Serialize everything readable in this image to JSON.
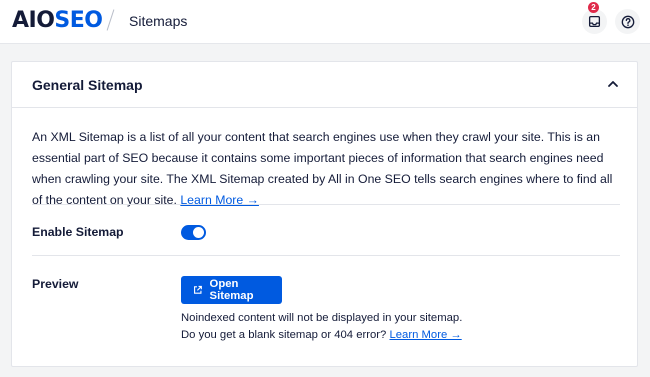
{
  "header": {
    "logo_text": "AIO",
    "logo_accent": "SEO",
    "breadcrumb": "Sitemaps",
    "notification_count": "2",
    "icons": [
      "inbox-icon",
      "help-icon"
    ]
  },
  "card": {
    "title": "General Sitemap",
    "collapse_icon": "chevron-up-icon",
    "description": "An XML Sitemap is a list of all your content that search engines use when they crawl your site. This is an essential part of SEO because it contains some important pieces of information that search engines need when crawling your site. The XML Sitemap created by All in One SEO tells search engines where to find all of the content on your site.",
    "learn_more": "Learn More →"
  },
  "enable_sitemap": {
    "label": "Enable Sitemap",
    "enabled": true
  },
  "preview": {
    "label": "Preview",
    "button_label": "Open Sitemap",
    "button_icon": "external-link-icon",
    "note": "Noindexed content will not be displayed in your sitemap.",
    "blank_question": "Do you get a blank sitemap or 404 error?",
    "learn_more": "Learn More →"
  },
  "colors": {
    "accent": "#005ae0",
    "text": "#141b38",
    "badge": "#df2a4a",
    "background": "#f3f4f5"
  }
}
